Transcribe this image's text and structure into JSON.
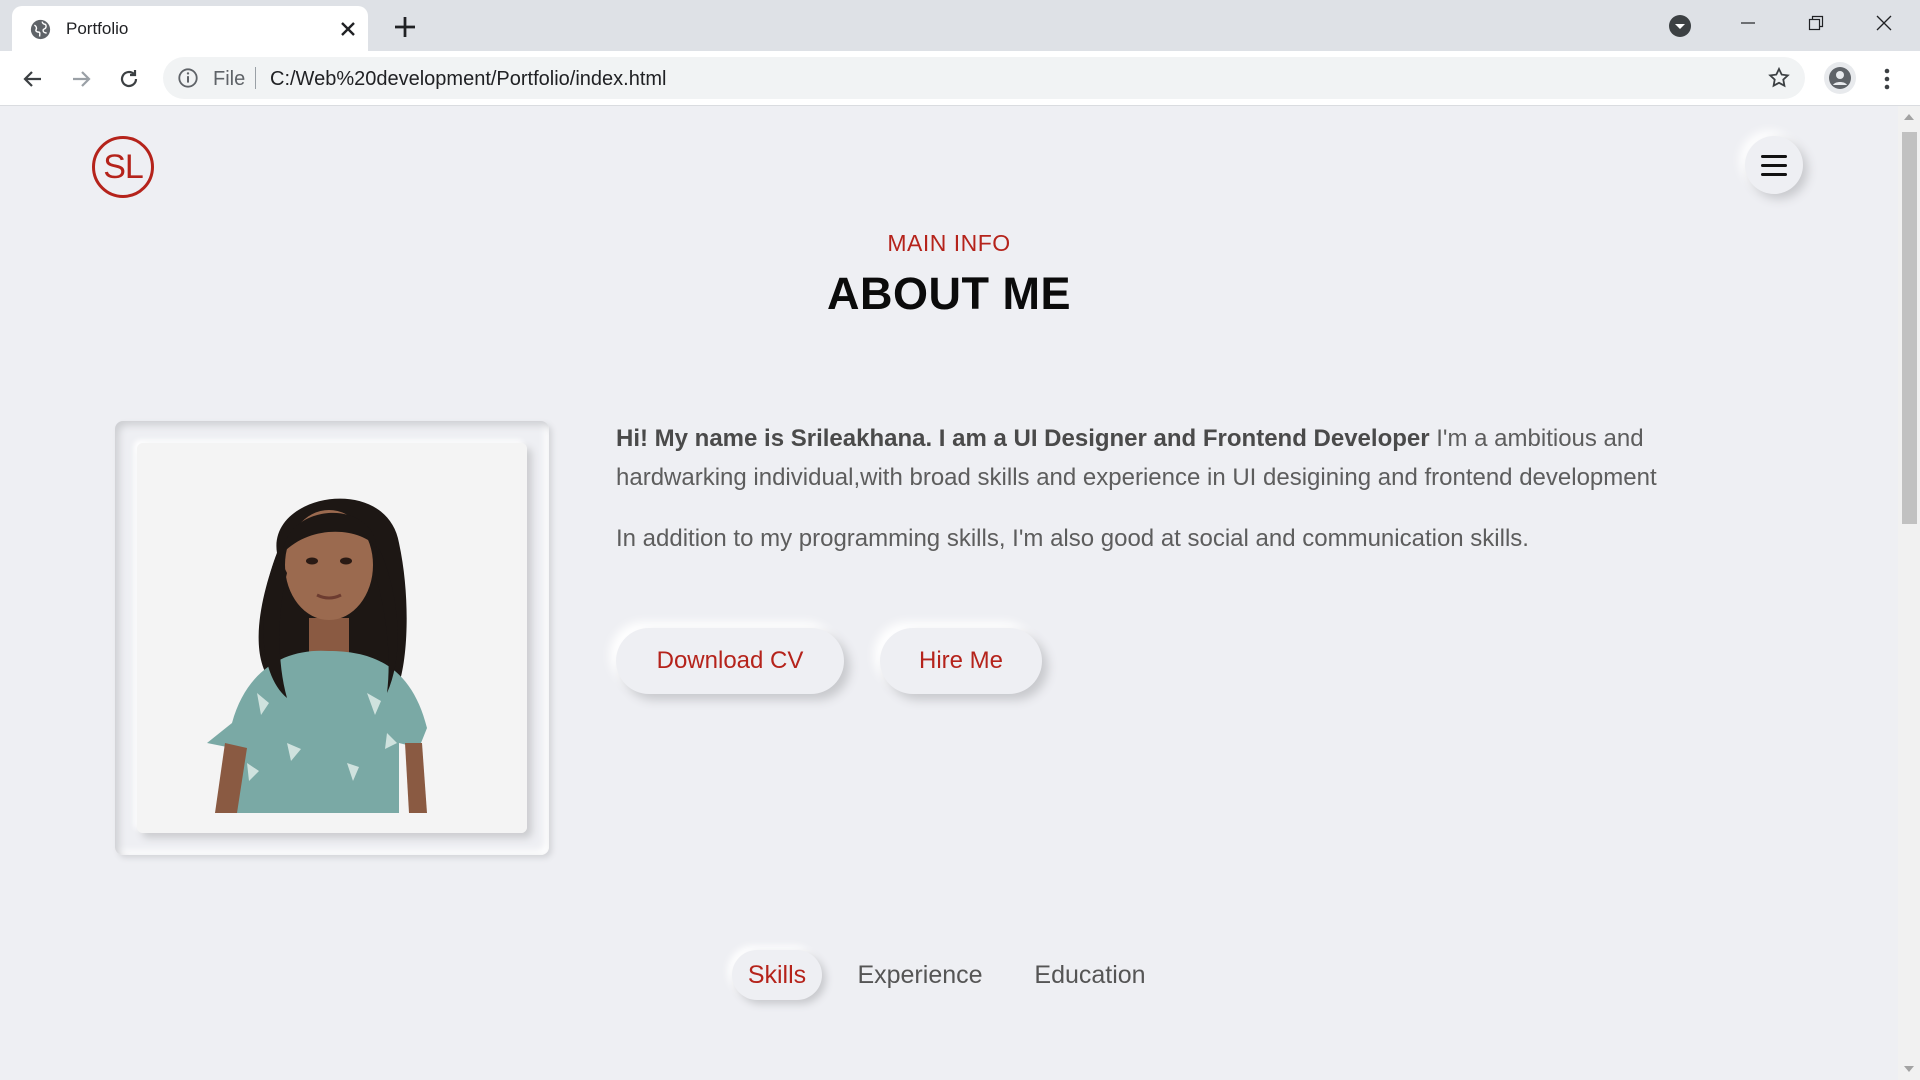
{
  "browser": {
    "tab_title": "Portfolio",
    "address_scheme_label": "File",
    "url": "C:/Web%20development/Portfolio/index.html"
  },
  "icons": {
    "favicon": "globe-icon",
    "close_tab": "close-icon",
    "new_tab": "plus-icon",
    "back": "arrow-left-icon",
    "forward": "arrow-right-icon",
    "reload": "reload-icon",
    "info": "info-icon",
    "bookmark": "star-icon",
    "profile": "user-icon",
    "menu": "kebab-menu-icon"
  },
  "page": {
    "logo_text": "SL",
    "kicker": "MAIN INFO",
    "heading": "ABOUT ME",
    "intro_bold": "Hi! My name is Srileakhana. I am a UI Designer and Frontend Developer",
    "intro_rest": " I'm a ambitious and hardwarking individual,with broad skills and experience in UI desigining and frontend development",
    "para2": "In addition to my programming skills, I'm also good at social and communication skills.",
    "buttons": {
      "download_cv": "Download CV",
      "hire_me": "Hire Me"
    },
    "tabs": [
      {
        "label": "Skills",
        "active": true
      },
      {
        "label": "Experience",
        "active": false
      },
      {
        "label": "Education",
        "active": false
      }
    ]
  },
  "colors": {
    "accent": "#b5231b",
    "page_bg": "#eeeff3"
  }
}
